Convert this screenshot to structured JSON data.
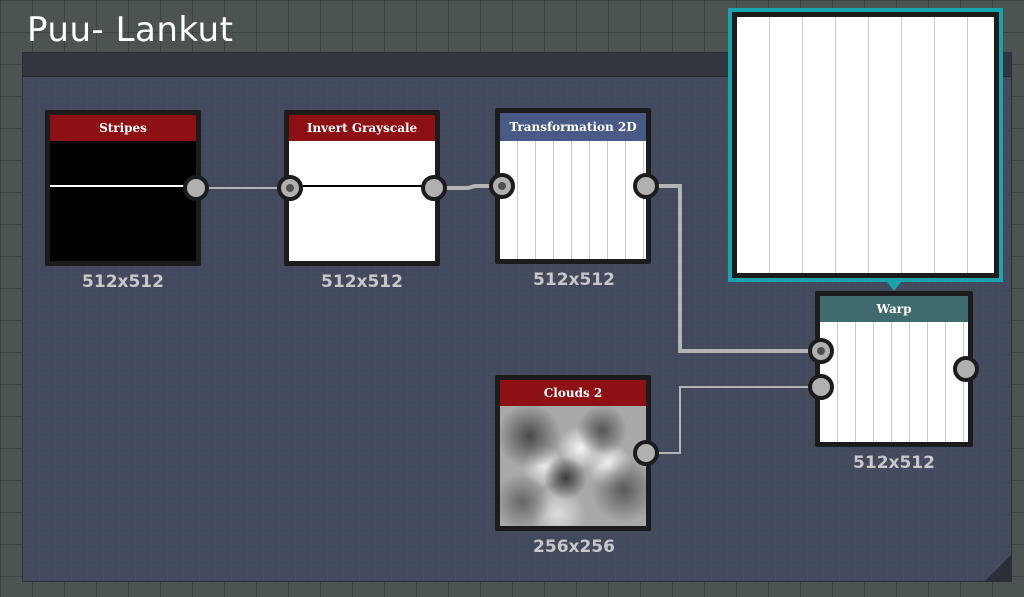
{
  "frame": {
    "title": "Puu- Lankut"
  },
  "nodes": {
    "stripes": {
      "title": "Stripes",
      "size": "512x512"
    },
    "invert": {
      "title": "Invert Grayscale",
      "size": "512x512"
    },
    "transform": {
      "title": "Transformation 2D",
      "size": "512x512"
    },
    "clouds": {
      "title": "Clouds 2",
      "size": "256x256"
    },
    "warp": {
      "title": "Warp",
      "size": "512x512"
    }
  },
  "colors": {
    "header_red": "#8c1014",
    "header_blue": "#4a5a86",
    "header_teal": "#3f6a6e",
    "preview_border": "#17a4ae"
  }
}
